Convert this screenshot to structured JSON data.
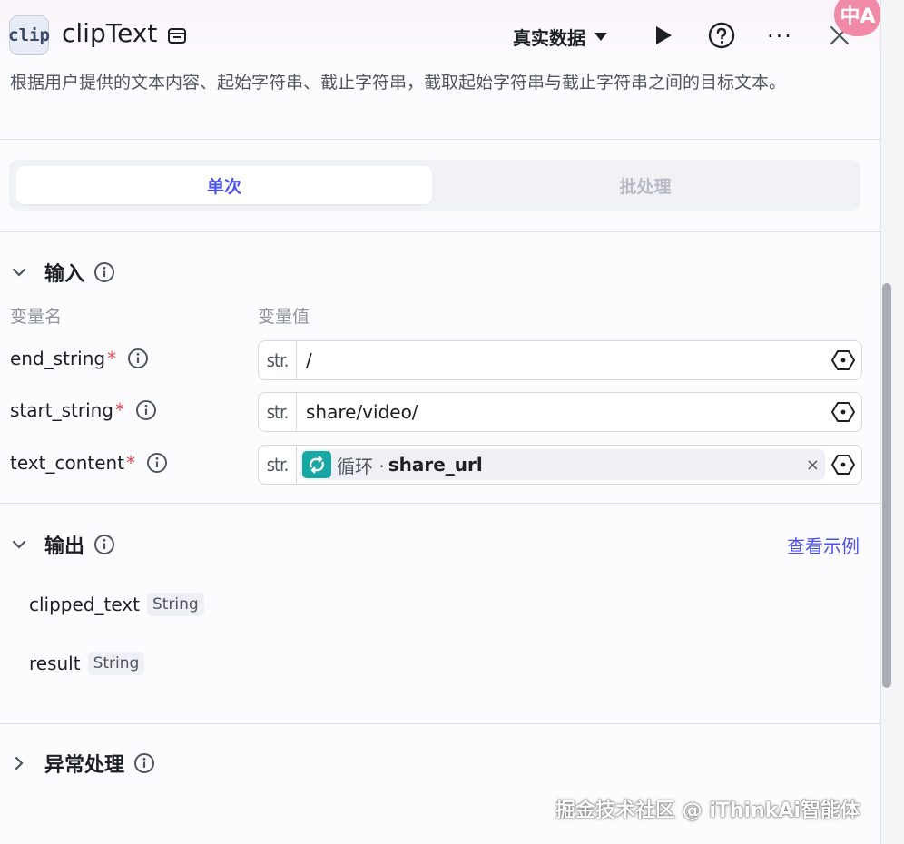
{
  "header": {
    "node_icon_text": "clip",
    "title": "clipText",
    "data_mode": "真实数据",
    "more_label": "···",
    "translate_badge": "中A"
  },
  "description": "根据用户提供的文本内容、起始字符串、截止字符串，截取起始字符串与截止字符串之间的目标文本。",
  "tabs": [
    {
      "label": "单次",
      "active": true
    },
    {
      "label": "批处理",
      "active": false
    }
  ],
  "input_section": {
    "title": "输入",
    "col_name": "变量名",
    "col_value": "变量值",
    "type_tag": "str.",
    "fields": [
      {
        "name": "end_string",
        "required": "*",
        "value": "/"
      },
      {
        "name": "start_string",
        "required": "*",
        "value": "share/video/"
      },
      {
        "name": "text_content",
        "required": "*",
        "ref_source": "循环 ·",
        "ref_var": "share_url",
        "clear": "×"
      }
    ]
  },
  "output_section": {
    "title": "输出",
    "example_link": "查看示例",
    "outputs": [
      {
        "name": "clipped_text",
        "type": "String"
      },
      {
        "name": "result",
        "type": "String"
      }
    ]
  },
  "exception_section": {
    "title": "异常处理"
  },
  "watermark": "掘金技术社区 @ iThinkAi智能体",
  "colors": {
    "accent": "#4d53e8",
    "loop_icon": "#17a7a5",
    "required": "#e5484d",
    "badge": "#f08aa6"
  }
}
